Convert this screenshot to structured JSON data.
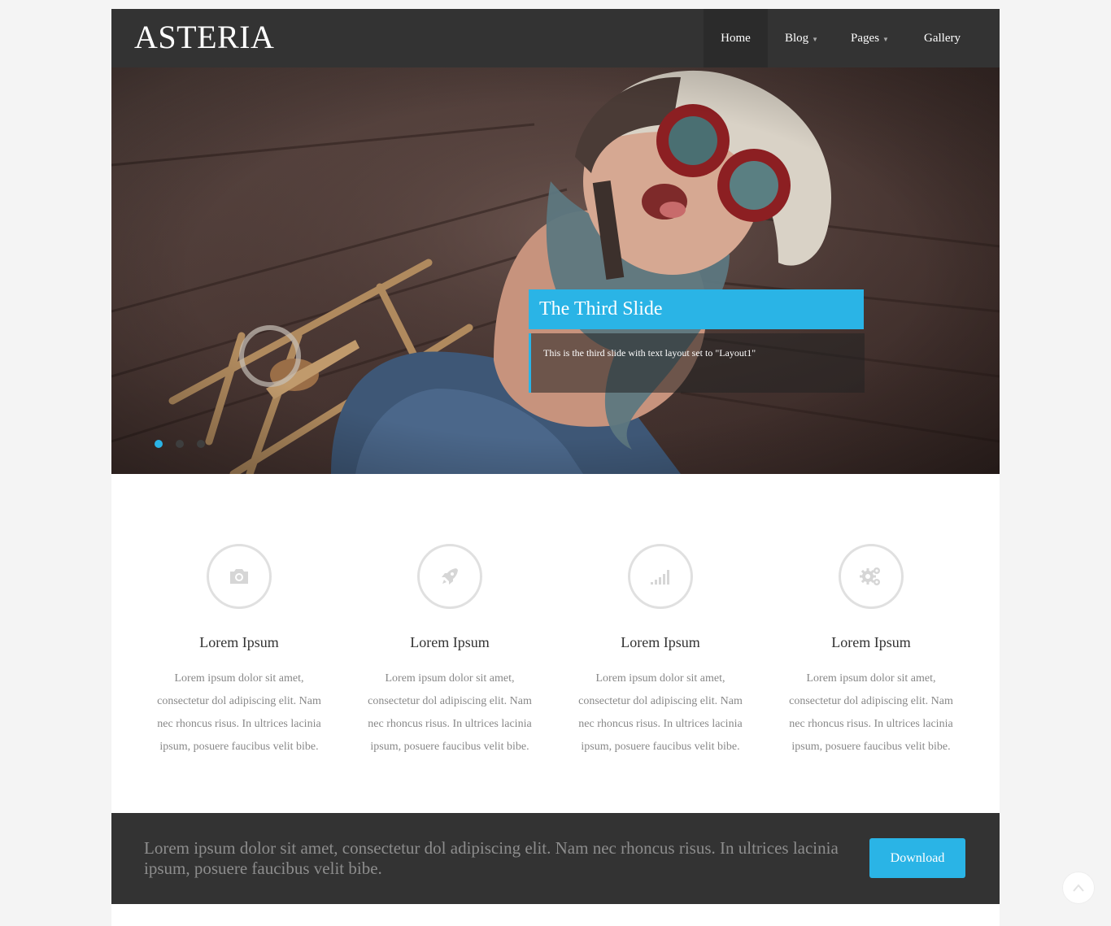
{
  "brand": {
    "name": "ASTERIA"
  },
  "nav": {
    "items": [
      {
        "label": "Home",
        "active": true,
        "dropdown": false
      },
      {
        "label": "Blog",
        "active": false,
        "dropdown": true
      },
      {
        "label": "Pages",
        "active": false,
        "dropdown": true
      },
      {
        "label": "Gallery",
        "active": false,
        "dropdown": false
      }
    ]
  },
  "slider": {
    "title": "The Third Slide",
    "caption": "This is the third slide with text layout set to \"Layout1\"",
    "slide_count": 3,
    "active_slide": 1
  },
  "features": [
    {
      "icon": "camera-icon",
      "title": "Lorem Ipsum",
      "text": "Lorem ipsum dolor sit amet, consectetur dol adipiscing elit. Nam nec rhoncus risus. In ultrices lacinia ipsum, posuere faucibus velit bibe."
    },
    {
      "icon": "rocket-icon",
      "title": "Lorem Ipsum",
      "text": "Lorem ipsum dolor sit amet, consectetur dol adipiscing elit. Nam nec rhoncus risus. In ultrices lacinia ipsum, posuere faucibus velit bibe."
    },
    {
      "icon": "signal-bars-icon",
      "title": "Lorem Ipsum",
      "text": "Lorem ipsum dolor sit amet, consectetur dol adipiscing elit. Nam nec rhoncus risus. In ultrices lacinia ipsum, posuere faucibus velit bibe."
    },
    {
      "icon": "gears-icon",
      "title": "Lorem Ipsum",
      "text": "Lorem ipsum dolor sit amet, consectetur dol adipiscing elit. Nam nec rhoncus risus. In ultrices lacinia ipsum, posuere faucibus velit bibe."
    }
  ],
  "cta": {
    "text": "Lorem ipsum dolor sit amet, consectetur dol adipiscing elit. Nam nec rhoncus risus. In ultrices lacinia ipsum, posuere faucibus velit bibe.",
    "button_label": "Download"
  },
  "colors": {
    "accent": "#2ab4e6",
    "header_bg": "#333333",
    "page_bg": "#f4f4f4"
  },
  "back_to_top": {
    "icon": "chevron-up-icon"
  }
}
